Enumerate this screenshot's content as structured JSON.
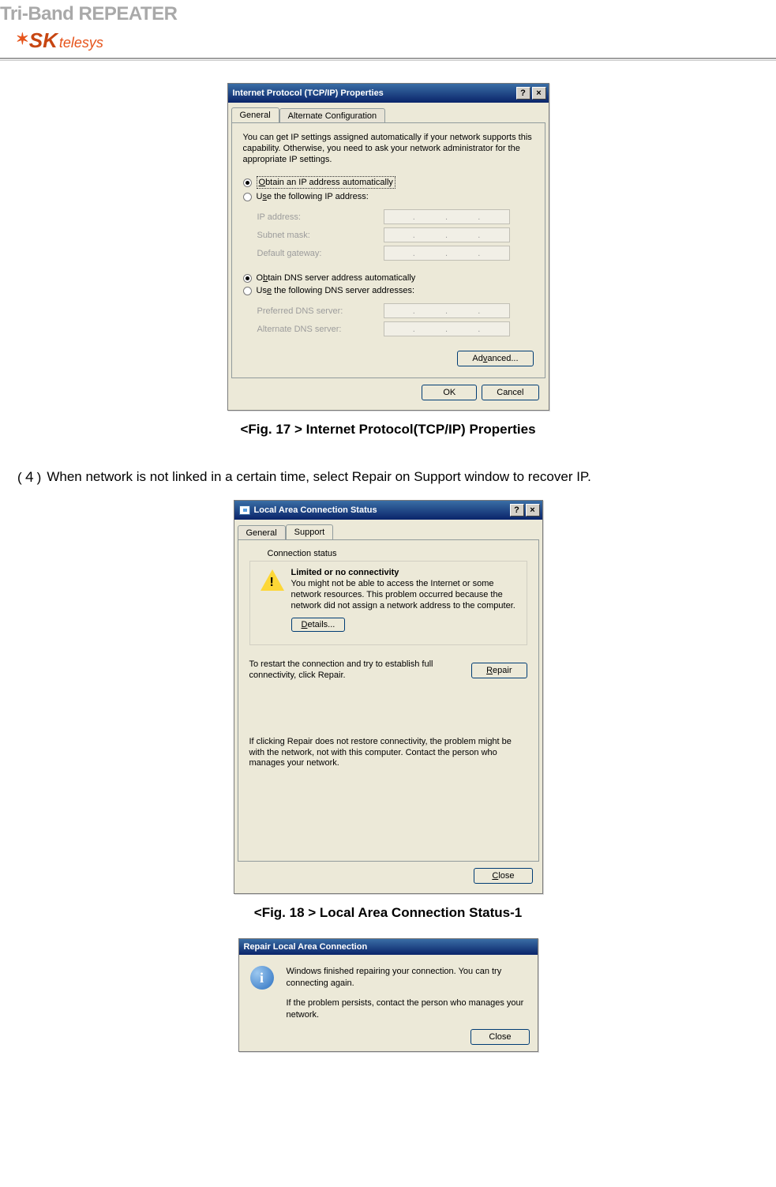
{
  "header": {
    "title": "Tri-Band REPEATER",
    "logo_sk": "SK",
    "logo_telesys": "telesys"
  },
  "dialog1": {
    "title": "Internet Protocol (TCP/IP) Properties",
    "help_btn": "?",
    "close_btn": "×",
    "tabs": {
      "general": "General",
      "alt": "Alternate Configuration"
    },
    "desc": "You can get IP settings assigned automatically if your network supports this capability. Otherwise, you need to ask your network administrator for the appropriate IP settings.",
    "radio_obtain_ip": "Obtain an IP address automatically",
    "radio_use_ip": "Use the following IP address:",
    "lbl_ip": "IP address:",
    "lbl_subnet": "Subnet mask:",
    "lbl_gateway": "Default gateway:",
    "radio_obtain_dns": "Obtain DNS server address automatically",
    "radio_use_dns": "Use the following DNS server addresses:",
    "lbl_pref_dns": "Preferred DNS server:",
    "lbl_alt_dns": "Alternate DNS server:",
    "btn_advanced": "Advanced...",
    "btn_ok": "OK",
    "btn_cancel": "Cancel"
  },
  "caption1": "<Fig. 17 > Internet Protocol(TCP/IP) Properties",
  "step4": {
    "num": "(４)",
    "text": "When network is not linked in a certain time, select Repair on Support window to recover IP."
  },
  "dialog2": {
    "title": "Local Area Connection Status",
    "help_btn": "?",
    "close_btn": "×",
    "tabs": {
      "general": "General",
      "support": "Support"
    },
    "legend": "Connection status",
    "warn_title": "Limited or no connectivity",
    "warn_text": "You might not be able to access the Internet or some network resources. This problem occurred because the network did not assign a network address to the computer.",
    "btn_details": "Details...",
    "repair_text": "To restart the connection and try to establish full connectivity, click Repair.",
    "btn_repair": "Repair",
    "note": "If clicking Repair does not restore connectivity, the problem might be with the network, not with this computer. Contact the person who manages your network.",
    "btn_close": "Close"
  },
  "caption2": "<Fig. 18 > Local Area Connection Status-1",
  "dialog3": {
    "title": "Repair Local Area Connection",
    "text1": "Windows finished repairing your connection. You can try connecting again.",
    "text2": "If the problem persists, contact the person who manages your network.",
    "btn_close": "Close"
  }
}
